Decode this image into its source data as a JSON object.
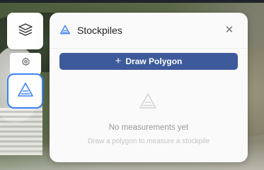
{
  "panel": {
    "title": "Stockpiles",
    "close_icon": "close-icon",
    "draw_button_label": "Draw Polygon",
    "empty_title": "No measurements yet",
    "empty_subtitle": "Draw a polygon to measure a stockpile"
  },
  "toolbar": {
    "items": [
      {
        "name": "layers",
        "icon": "layers-icon"
      },
      {
        "name": "settings",
        "icon": "gear-icon"
      },
      {
        "name": "stockpiles",
        "icon": "stockpile-icon",
        "active": true
      }
    ]
  },
  "colors": {
    "accent": "#3b82f6",
    "button": "#3d5a9a"
  }
}
